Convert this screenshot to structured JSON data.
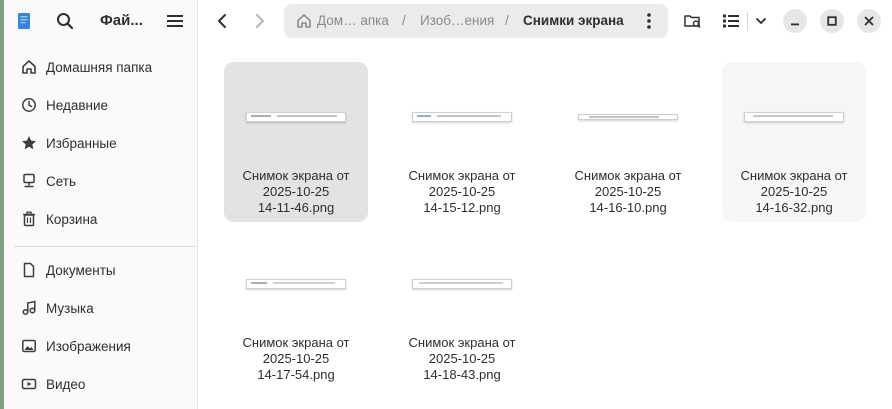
{
  "sidebar": {
    "title": "Фай...",
    "items": [
      {
        "label": "Домашняя папка",
        "icon": "home-icon"
      },
      {
        "label": "Недавние",
        "icon": "clock-icon"
      },
      {
        "label": "Избранные",
        "icon": "star-icon"
      },
      {
        "label": "Сеть",
        "icon": "network-icon"
      },
      {
        "label": "Корзина",
        "icon": "trash-icon"
      }
    ],
    "places": [
      {
        "label": "Документы",
        "icon": "document-icon"
      },
      {
        "label": "Музыка",
        "icon": "music-icon"
      },
      {
        "label": "Изображения",
        "icon": "image-icon"
      },
      {
        "label": "Видео",
        "icon": "video-icon"
      }
    ]
  },
  "pathbar": {
    "home": "Дом… апка",
    "middle": "Изоб…ения",
    "current": "Снимки экрана",
    "separator": "/"
  },
  "files": [
    {
      "line1": "Снимок экрана от",
      "line2": "2025-10-25",
      "line3": "14-11-46.png",
      "state": "selected"
    },
    {
      "line1": "Снимок экрана от",
      "line2": "2025-10-25",
      "line3": "14-15-12.png",
      "state": "normal"
    },
    {
      "line1": "Снимок экрана от",
      "line2": "2025-10-25",
      "line3": "14-16-10.png",
      "state": "normal"
    },
    {
      "line1": "Снимок экрана от",
      "line2": "2025-10-25",
      "line3": "14-16-32.png",
      "state": "hover"
    },
    {
      "line1": "Снимок экрана от",
      "line2": "2025-10-25",
      "line3": "14-17-54.png",
      "state": "normal"
    },
    {
      "line1": "Снимок экрана от",
      "line2": "2025-10-25",
      "line3": "14-18-43.png",
      "state": "normal"
    }
  ],
  "colors": {
    "accent": "#3584e4",
    "sidebar_bg": "#fafafa",
    "pathbar_bg": "#ebebeb",
    "selected_tile": "#e3e3e3"
  }
}
